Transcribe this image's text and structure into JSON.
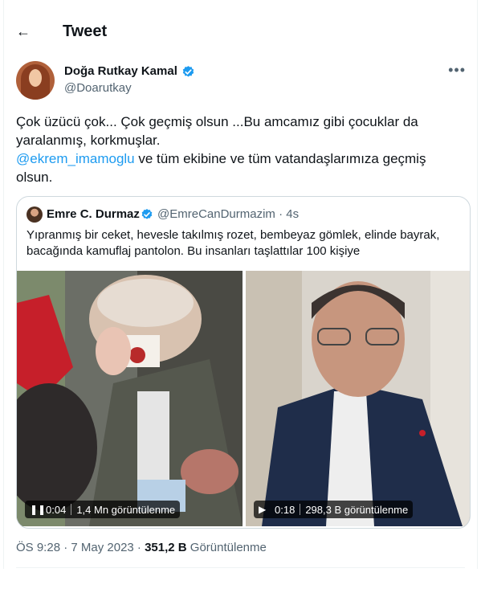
{
  "topbar": {
    "back_icon": "back-arrow-icon",
    "title": "Tweet"
  },
  "author": {
    "name": "Doğa Rutkay Kamal",
    "handle": "@Doarutkay",
    "verified_icon": "verified-badge-icon",
    "more_icon": "more-icon"
  },
  "tweet": {
    "line1": "Çok üzücü çok... Çok geçmiş olsun ...Bu amcamız gibi çocuklar da yaralanmış, korkmuşlar.",
    "mention": "@ekrem_imamoglu",
    "line2_rest": " ve tüm ekibine ve tüm vatandaşlarımıza geçmiş olsun."
  },
  "quote": {
    "name": "Emre C. Durmaz",
    "handle_time": "@EmreCanDurmazim · 4s",
    "text": "Yıpranmış bir ceket, hevesle takılmış rozet, bembeyaz gömlek, elinde bayrak, bacağında kamuflaj pantolon. Bu insanları taşlattılar 100 kişiye",
    "videos": [
      {
        "state_icon": "pause-icon",
        "time": "0:04",
        "views": "1,4 Mn görüntülenme"
      },
      {
        "state_icon": "play-icon",
        "time": "0:18",
        "views": "298,3 B görüntülenme"
      }
    ]
  },
  "meta": {
    "time_date": "ÖS 9:28 · 7 May 2023 · ",
    "views_count": "351,2 B",
    "views_label": " Görüntülenme"
  },
  "colors": {
    "accent": "#1d9bf0",
    "text": "#0f1419",
    "muted": "#536471",
    "border": "#cfd9de"
  }
}
